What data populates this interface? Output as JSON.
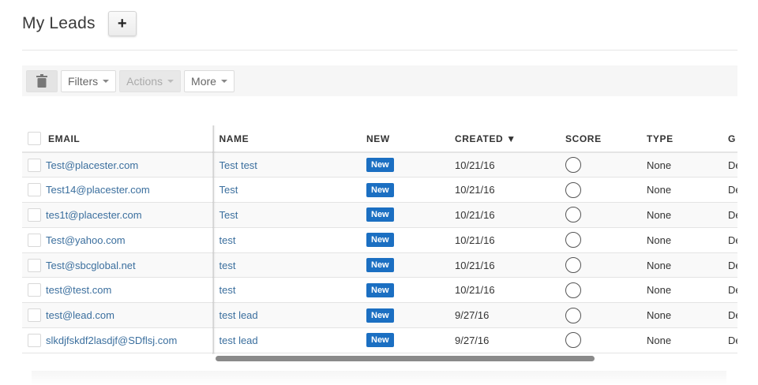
{
  "header": {
    "title": "My Leads",
    "add_label": "+"
  },
  "toolbar": {
    "trash_icon": "trash-icon",
    "filters_label": "Filters",
    "actions_label": "Actions",
    "more_label": "More"
  },
  "columns": {
    "email": "EMAIL",
    "name": "NAME",
    "new": "NEW",
    "created": "CREATED ▼",
    "score": "SCORE",
    "type": "TYPE",
    "extra": "G"
  },
  "rows": [
    {
      "email": "Test@placester.com",
      "name": "Test test",
      "status": "New",
      "created": "10/21/16",
      "type": "None",
      "extra": "De"
    },
    {
      "email": "Test14@placester.com",
      "name": "Test",
      "status": "New",
      "created": "10/21/16",
      "type": "None",
      "extra": "De"
    },
    {
      "email": "tes1t@placester.com",
      "name": "Test",
      "status": "New",
      "created": "10/21/16",
      "type": "None",
      "extra": "De"
    },
    {
      "email": "Test@yahoo.com",
      "name": "test",
      "status": "New",
      "created": "10/21/16",
      "type": "None",
      "extra": "De"
    },
    {
      "email": "Test@sbcglobal.net",
      "name": "test",
      "status": "New",
      "created": "10/21/16",
      "type": "None",
      "extra": "De"
    },
    {
      "email": "test@test.com",
      "name": "test",
      "status": "New",
      "created": "10/21/16",
      "type": "None",
      "extra": "De"
    },
    {
      "email": "test@lead.com",
      "name": "test lead",
      "status": "New",
      "created": "9/27/16",
      "type": "None",
      "extra": "De"
    },
    {
      "email": "slkdjfskdf2lasdjf@SDflsj.com",
      "name": "test lead",
      "status": "New",
      "created": "9/27/16",
      "type": "None",
      "extra": "De"
    }
  ],
  "colors": {
    "badge": "#1b6fc2",
    "link": "#3b6f9e"
  }
}
